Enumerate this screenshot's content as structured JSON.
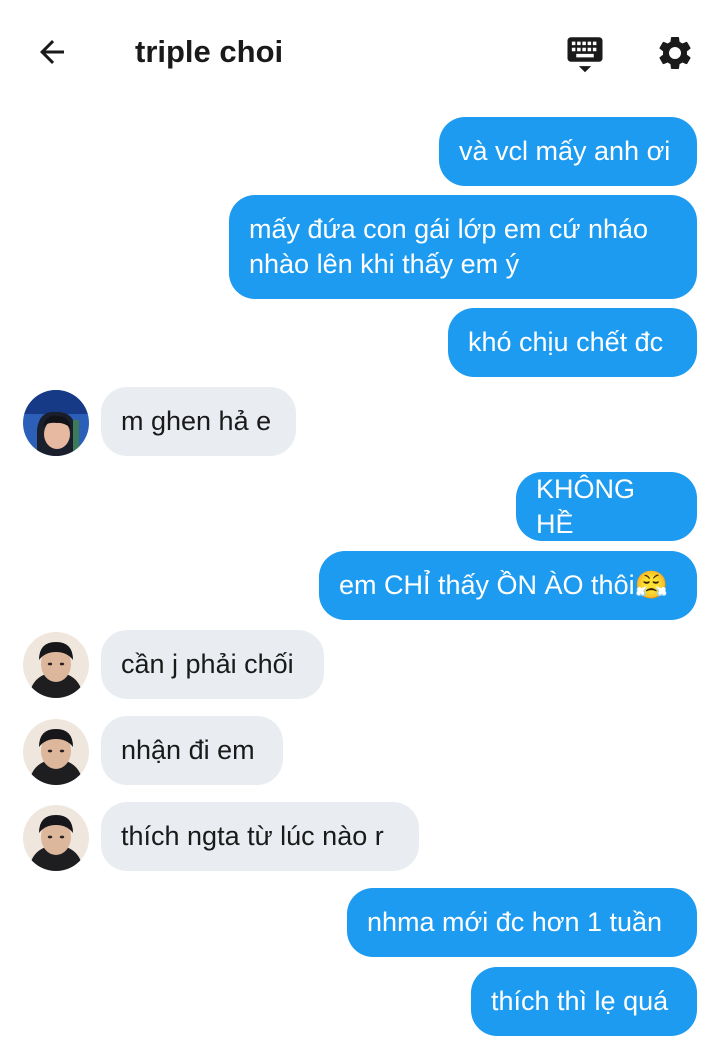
{
  "header": {
    "title": "triple choi",
    "back_icon": "arrow-left-icon",
    "keyboard_icon": "keyboard-icon",
    "settings_icon": "gear-icon"
  },
  "colors": {
    "outgoing_bubble": "#1d9bf0",
    "incoming_bubble": "#e9edf1",
    "text_dark": "#1a1a1a"
  },
  "messages": [
    {
      "direction": "out",
      "text": "và vcl mấy anh ơi"
    },
    {
      "direction": "out",
      "text": "mấy đứa con gái lớp em cứ nháo\nnhào lên khi thấy em ý"
    },
    {
      "direction": "out",
      "text": "khó chịu chết đc"
    },
    {
      "direction": "in",
      "sender": "blue-avatar",
      "text": "m ghen hả e"
    },
    {
      "direction": "out",
      "text": "KHÔNG HỀ"
    },
    {
      "direction": "out",
      "text": "em CHỈ thấy ỒN ÀO thôi😤"
    },
    {
      "direction": "in",
      "sender": "dark-avatar",
      "text": "cần j phải chối"
    },
    {
      "direction": "in",
      "sender": "dark-avatar",
      "text": "nhận đi em"
    },
    {
      "direction": "in",
      "sender": "dark-avatar",
      "text": "thích ngta từ lúc nào r"
    },
    {
      "direction": "out",
      "text": "nhma mới đc hơn 1 tuần"
    },
    {
      "direction": "out",
      "text": "thích thì lẹ quá"
    }
  ]
}
